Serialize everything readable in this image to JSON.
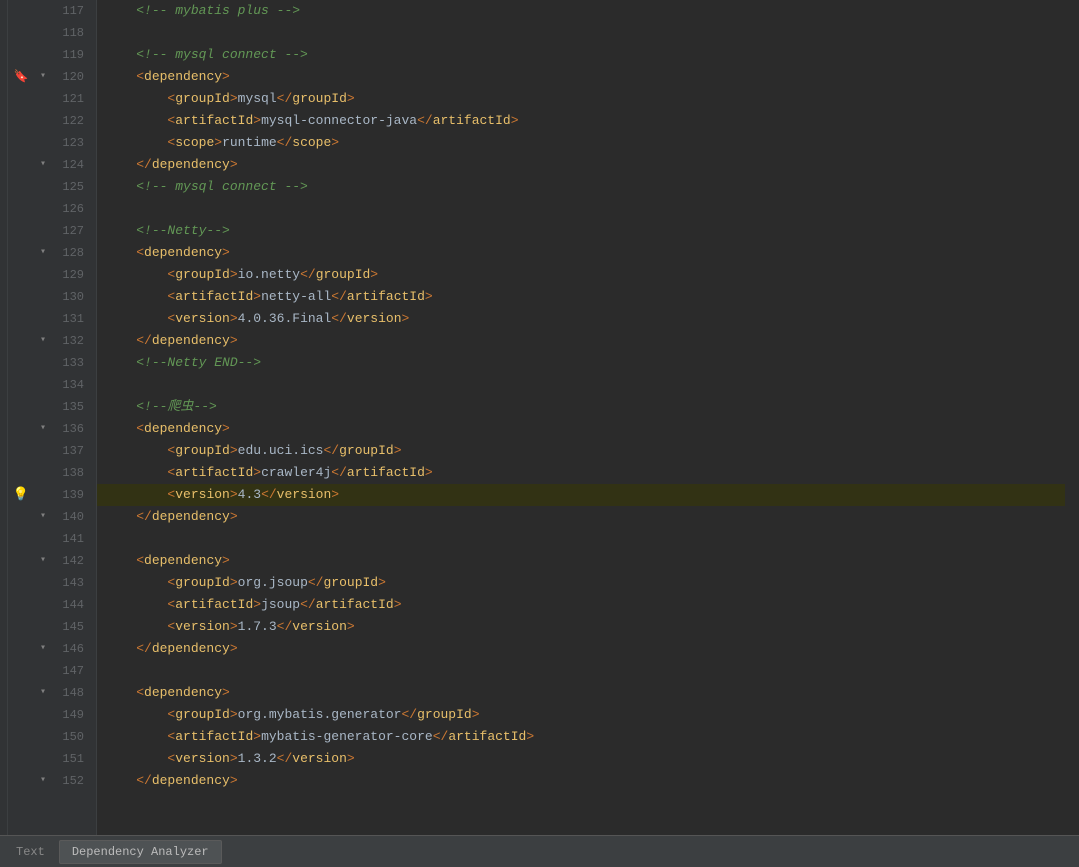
{
  "editor": {
    "background": "#2b2b2b",
    "lines": [
      {
        "num": 117,
        "indent": 1,
        "type": "comment",
        "content": "<!-- mybatis plus -->"
      },
      {
        "num": 118,
        "indent": 0,
        "type": "empty",
        "content": ""
      },
      {
        "num": 119,
        "indent": 1,
        "type": "comment",
        "content": "<!-- mysql connect -->"
      },
      {
        "num": 120,
        "indent": 1,
        "type": "open-tag",
        "content": "<dependency>",
        "icons": [
          "bookmark",
          "fold"
        ]
      },
      {
        "num": 121,
        "indent": 2,
        "type": "tag-line",
        "content": "<groupId>mysql</groupId>"
      },
      {
        "num": 122,
        "indent": 2,
        "type": "tag-line",
        "content": "<artifactId>mysql-connector-java</artifactId>"
      },
      {
        "num": 123,
        "indent": 2,
        "type": "tag-line",
        "content": "<scope>runtime</scope>"
      },
      {
        "num": 124,
        "indent": 1,
        "type": "close-tag-line",
        "content": "</dependency>",
        "icons": [
          "fold"
        ]
      },
      {
        "num": 125,
        "indent": 1,
        "type": "comment",
        "content": "<!-- mysql connect -->"
      },
      {
        "num": 126,
        "indent": 0,
        "type": "empty",
        "content": ""
      },
      {
        "num": 127,
        "indent": 1,
        "type": "comment",
        "content": "<!--Netty-->"
      },
      {
        "num": 128,
        "indent": 1,
        "type": "open-tag",
        "content": "<dependency>",
        "icons": [
          "fold"
        ]
      },
      {
        "num": 129,
        "indent": 2,
        "type": "tag-line",
        "content": "<groupId>io.netty</groupId>"
      },
      {
        "num": 130,
        "indent": 2,
        "type": "tag-line",
        "content": "<artifactId>netty-all</artifactId>"
      },
      {
        "num": 131,
        "indent": 2,
        "type": "tag-line",
        "content": "<version>4.0.36.Final</version>"
      },
      {
        "num": 132,
        "indent": 1,
        "type": "close-tag-line",
        "content": "</dependency>",
        "icons": [
          "fold"
        ]
      },
      {
        "num": 133,
        "indent": 1,
        "type": "comment",
        "content": "<!--Netty END-->"
      },
      {
        "num": 134,
        "indent": 0,
        "type": "empty",
        "content": ""
      },
      {
        "num": 135,
        "indent": 1,
        "type": "comment",
        "content": "<!--爬虫-->"
      },
      {
        "num": 136,
        "indent": 1,
        "type": "open-tag",
        "content": "<dependency>",
        "icons": [
          "fold"
        ]
      },
      {
        "num": 137,
        "indent": 2,
        "type": "tag-line",
        "content": "<groupId>edu.uci.ics</groupId>"
      },
      {
        "num": 138,
        "indent": 2,
        "type": "tag-line",
        "content": "<artifactId>crawler4j</artifactId>"
      },
      {
        "num": 139,
        "indent": 2,
        "type": "tag-line",
        "content": "<version>4.3</version>",
        "highlighted": true,
        "icons": [
          "bulb"
        ]
      },
      {
        "num": 140,
        "indent": 1,
        "type": "close-tag-line",
        "content": "</dependency>",
        "icons": [
          "fold"
        ]
      },
      {
        "num": 141,
        "indent": 0,
        "type": "empty",
        "content": ""
      },
      {
        "num": 142,
        "indent": 1,
        "type": "open-tag",
        "content": "<dependency>",
        "icons": [
          "fold"
        ]
      },
      {
        "num": 143,
        "indent": 2,
        "type": "tag-line",
        "content": "<groupId>org.jsoup</groupId>"
      },
      {
        "num": 144,
        "indent": 2,
        "type": "tag-line",
        "content": "<artifactId>jsoup</artifactId>"
      },
      {
        "num": 145,
        "indent": 2,
        "type": "tag-line",
        "content": "<version>1.7.3</version>"
      },
      {
        "num": 146,
        "indent": 1,
        "type": "close-tag-line",
        "content": "</dependency>",
        "icons": [
          "fold"
        ]
      },
      {
        "num": 147,
        "indent": 0,
        "type": "empty",
        "content": ""
      },
      {
        "num": 148,
        "indent": 1,
        "type": "open-tag",
        "content": "<dependency>",
        "icons": [
          "fold"
        ]
      },
      {
        "num": 149,
        "indent": 2,
        "type": "tag-line",
        "content": "<groupId>org.mybatis.generator</groupId>"
      },
      {
        "num": 150,
        "indent": 2,
        "type": "tag-line",
        "content": "<artifactId>mybatis-generator-core</artifactId>"
      },
      {
        "num": 151,
        "indent": 2,
        "type": "tag-line",
        "content": "<version>1.3.2</version>"
      },
      {
        "num": 152,
        "indent": 1,
        "type": "close-tag-line",
        "content": "</dependency>",
        "icons": [
          "fold"
        ]
      }
    ]
  },
  "statusbar": {
    "tabs": [
      {
        "id": "text",
        "label": "Text",
        "active": false
      },
      {
        "id": "dependency-analyzer",
        "label": "Dependency Analyzer",
        "active": true
      }
    ]
  }
}
